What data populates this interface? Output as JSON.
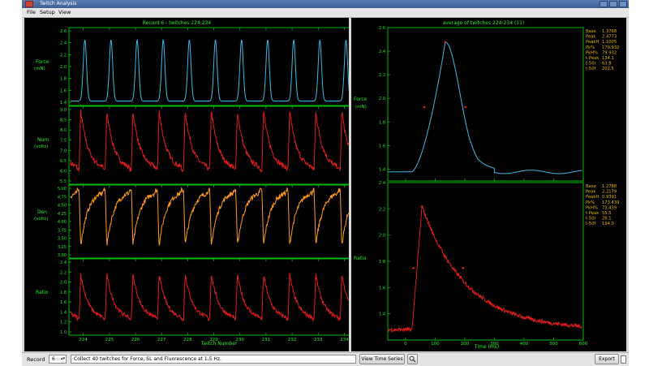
{
  "window": {
    "title": "Twitch Analysis"
  },
  "menu": [
    "File",
    "Setup",
    "View"
  ],
  "colors": {
    "background": "#000000",
    "axis": "#00b800",
    "text": "#22ee22",
    "stats": "#e6b800",
    "force": "#3ab8e6",
    "ratio": "#e21c1c",
    "den": "#ff9a1a"
  },
  "left_panel": {
    "title": "Record 6 - twitches 224:234",
    "xlabel": "Twitch Number",
    "x_ticks": [
      "224",
      "225",
      "226",
      "227",
      "228",
      "229",
      "230",
      "231",
      "232",
      "233",
      "234"
    ],
    "panels": [
      {
        "label": "Force",
        "unit": "(mN)",
        "ticks": [
          "2.6",
          "2.4",
          "2.2",
          "2.0",
          "1.8",
          "1.6",
          "1.4"
        ]
      },
      {
        "label": "Num",
        "unit": "(volts)",
        "ticks": [
          "9.0",
          "8.5",
          "8.0",
          "7.5",
          "7.0",
          "6.5",
          "6.0",
          "5.5"
        ]
      },
      {
        "label": "Den",
        "unit": "(volts)",
        "ticks": [
          "5.00",
          "4.75",
          "4.50",
          "4.25",
          "4.00",
          "3.75",
          "3.50",
          "3.25",
          "3.00"
        ]
      },
      {
        "label": "Ratio",
        "unit": "",
        "ticks": [
          "2.4",
          "2.2",
          "2.0",
          "1.8",
          "1.6",
          "1.4",
          "1.2",
          "1.0"
        ]
      }
    ]
  },
  "right_panel": {
    "title": "average of twitches 224-234 (11)",
    "xlabel": "Time (ms)",
    "x_ticks": [
      "0",
      "100",
      "200",
      "300",
      "400",
      "500",
      "600"
    ],
    "force": {
      "label": "Force",
      "unit": "(mN)",
      "ticks": [
        "2.6",
        "2.4",
        "2.2",
        "2.0",
        "1.8",
        "1.6",
        "1.4"
      ],
      "stats": [
        {
          "k": "Base",
          "v": "1.3768"
        },
        {
          "k": "Peak",
          "v": "2.4773"
        },
        {
          "k": "PeakH",
          "v": "1.1005"
        },
        {
          "k": "Pk%",
          "v": "179.932"
        },
        {
          "k": "PkH%",
          "v": "79.932"
        },
        {
          "k": "t-Peak",
          "v": "134.1"
        },
        {
          "k": "t-50r",
          "v": "63.8"
        },
        {
          "k": "t-50f",
          "v": "202.5"
        }
      ]
    },
    "ratio": {
      "label": "Ratio",
      "ticks": [
        "2.4",
        "2.2",
        "2.0",
        "1.8",
        "1.6",
        "1.4"
      ],
      "stats": [
        {
          "k": "Base",
          "v": "1.2788"
        },
        {
          "k": "Peak",
          "v": "2.2179"
        },
        {
          "k": "PeakH",
          "v": "0.9391"
        },
        {
          "k": "Pk%",
          "v": "173.439"
        },
        {
          "k": "PkH%",
          "v": "73.439"
        },
        {
          "k": "t-Peak",
          "v": "55.5"
        },
        {
          "k": "t-50r",
          "v": "26.1"
        },
        {
          "k": "t-50f",
          "v": "194.0"
        }
      ]
    }
  },
  "bottom": {
    "record_label": "Record",
    "record_value": "6",
    "description": "Collect 40 twitches for Force, SL and Fluorescence at 1.5 Hz.",
    "time_series_button": "View Time Series",
    "export_button": "Export"
  },
  "chart_data": [
    {
      "type": "line",
      "title": "Record 6 - twitches 224:234",
      "xlabel": "Twitch Number",
      "x_categories": [
        "224",
        "225",
        "226",
        "227",
        "228",
        "229",
        "230",
        "231",
        "232",
        "233",
        "234"
      ],
      "series": [
        {
          "name": "Force",
          "ylabel": "Force (mN)",
          "ylim": [
            1.3,
            2.7
          ],
          "baseline": 1.38,
          "peak": 2.48,
          "shape": "force"
        },
        {
          "name": "Num",
          "ylabel": "Num (volts)",
          "ylim": [
            5.4,
            9.1
          ],
          "baseline": 6.1,
          "peak": 8.9,
          "shape": "calcium",
          "noise": 0.12
        },
        {
          "name": "Den",
          "ylabel": "Den (volts)",
          "ylim": [
            2.95,
            5.05
          ],
          "baseline": 4.9,
          "peak": 3.3,
          "shape": "dip",
          "noise": 0.07
        },
        {
          "name": "Ratio",
          "ylabel": "Ratio",
          "ylim": [
            0.95,
            2.5
          ],
          "baseline": 1.28,
          "peak": 2.2,
          "shape": "calcium",
          "noise": 0.04
        }
      ],
      "twitch_count": 11,
      "grid": true
    },
    {
      "type": "line",
      "title": "average of twitches 224-234 (11)",
      "xlabel": "Time (ms)",
      "xlim": [
        -60,
        600
      ],
      "panels": [
        {
          "name": "Force",
          "ylim": [
            1.3,
            2.6
          ],
          "base": 1.3768,
          "peak": 2.4773,
          "t_peak": 134.1,
          "t50r": 63.8,
          "t50f": 202.5
        },
        {
          "name": "Ratio",
          "ylim": [
            1.2,
            2.4
          ],
          "base": 1.2788,
          "peak": 2.2179,
          "t_peak": 55.5,
          "t50r": 26.1,
          "t50f": 194.0
        }
      ],
      "grid": true
    }
  ]
}
